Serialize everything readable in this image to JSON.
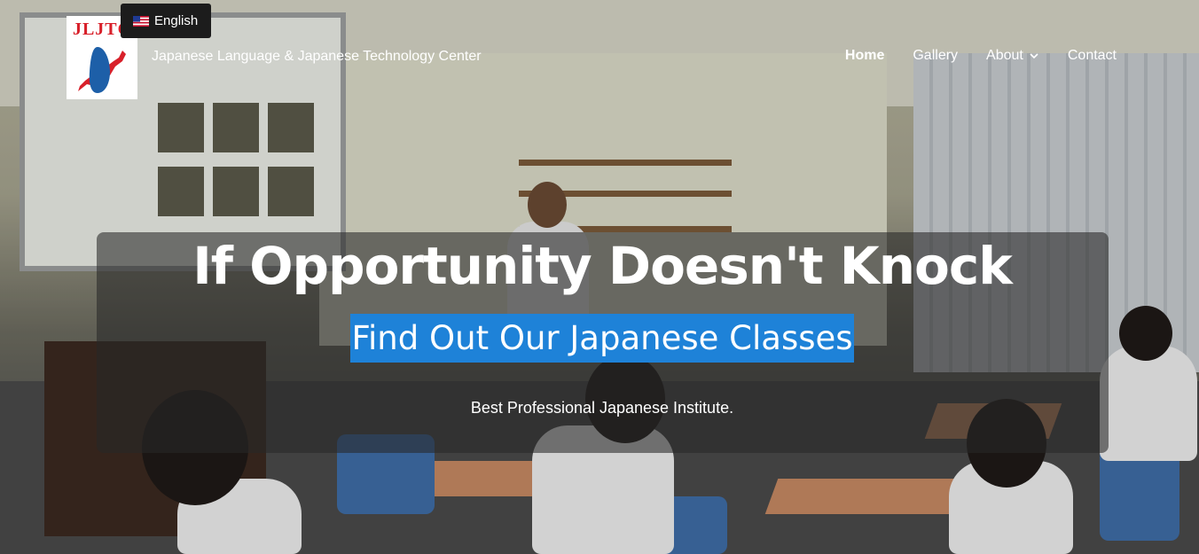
{
  "header": {
    "logo_text": "JLJTC",
    "language": {
      "label": "English",
      "flag": "us-flag-icon"
    },
    "site_title": "Japanese Language & Japanese Technology Center"
  },
  "nav": {
    "items": [
      {
        "label": "Home",
        "active": true
      },
      {
        "label": "Gallery",
        "active": false
      },
      {
        "label": "About",
        "active": false,
        "has_dropdown": true
      },
      {
        "label": "Contact",
        "active": false
      }
    ]
  },
  "hero": {
    "headline": "If Opportunity Doesn't Knock",
    "subheadline": "Find Out Our Japanese Classes",
    "tagline": "Best Professional Japanese Institute."
  },
  "colors": {
    "subheadline_highlight": "#1e82d8",
    "overlay": "rgba(40,40,40,0.58)",
    "logo_red": "#d8202a"
  }
}
